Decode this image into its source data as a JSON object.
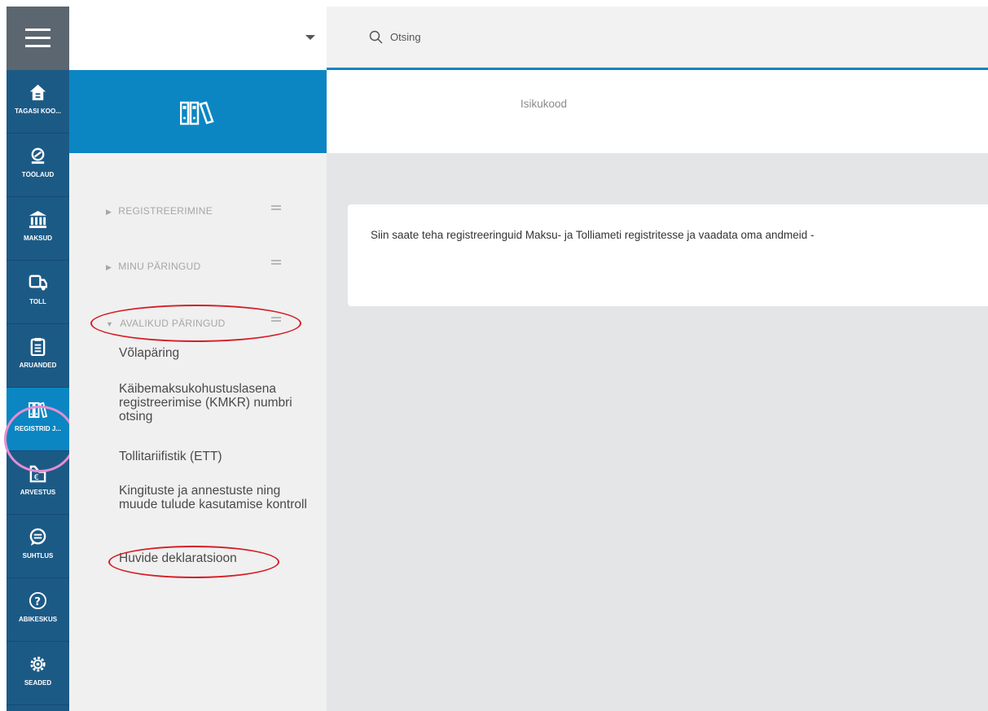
{
  "search": {
    "placeholder": "Otsing"
  },
  "rail": {
    "items": [
      {
        "label": "TAGASI KOO...",
        "icon": "home-icon"
      },
      {
        "label": "TÖÖLAUD",
        "icon": "dashboard-icon"
      },
      {
        "label": "MAKSUD",
        "icon": "bank-icon"
      },
      {
        "label": "TOLL",
        "icon": "truck-icon"
      },
      {
        "label": "ARUANDED",
        "icon": "clipboard-icon"
      },
      {
        "label": "REGISTRID J...",
        "icon": "binders-icon"
      },
      {
        "label": "ARVESTUS",
        "icon": "accounting-icon"
      },
      {
        "label": "SUHTLUS",
        "icon": "chat-icon"
      },
      {
        "label": "ABIKESKUS",
        "icon": "help-icon"
      },
      {
        "label": "SEADED",
        "icon": "gear-icon"
      }
    ],
    "active": "REGISTRID J..."
  },
  "subnav": {
    "sections": [
      {
        "label": "REGISTREERIMINE",
        "expanded": false
      },
      {
        "label": "MINU PÄRINGUD",
        "expanded": false
      },
      {
        "label": "AVALIKUD PÄRINGUD",
        "expanded": true
      }
    ],
    "links": [
      "Võlapäring",
      "Käibemaksukohustuslasena registreerimise (KMKR) numbri otsing",
      "Tollitariifistik (ETT)",
      "Kingituste ja annestuste ning muude tulude kasutamise kontroll",
      "Huvide deklaratsioon"
    ]
  },
  "id_bar": {
    "label": "Isikukood"
  },
  "main": {
    "info_text": "Siin saate teha registreeringuid Maksu- ja Tolliameti registritesse ja vaadata oma andmeid -"
  },
  "colors": {
    "rail_bg": "#1c5a86",
    "accent": "#0b86c3",
    "hamburger_bg": "#5b6670",
    "annotation_red": "#d41f26",
    "annotation_pink": "#e58ed0"
  }
}
